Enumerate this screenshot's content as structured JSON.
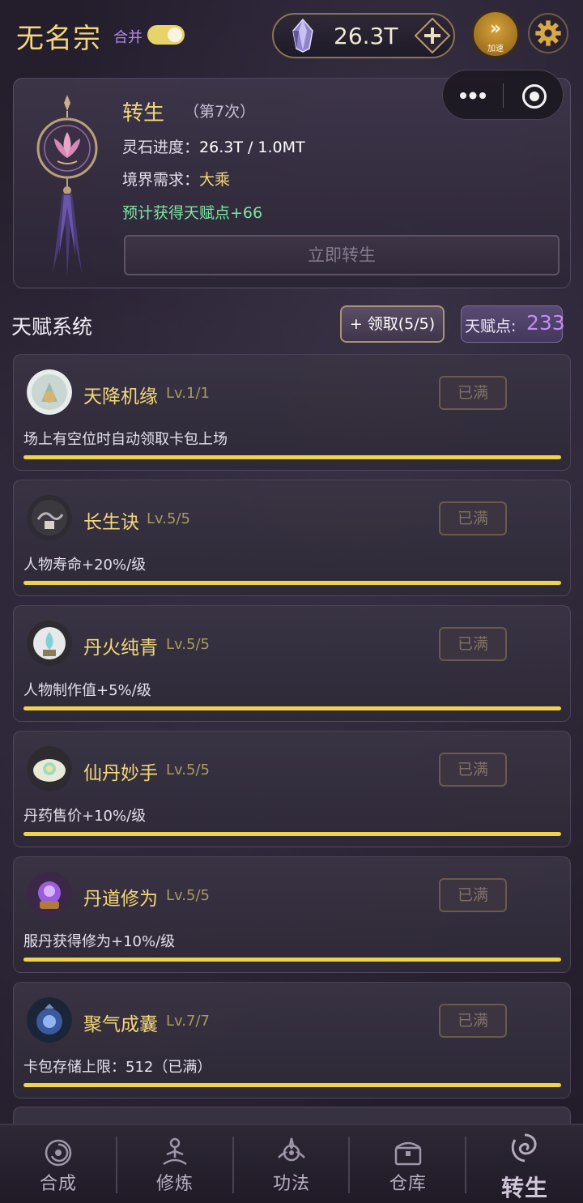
{
  "header": {
    "title": "无名宗",
    "merge_label": "合并",
    "merge_on": true,
    "currency_amount": "26.3T",
    "speed_label": "加速"
  },
  "rebirth": {
    "title": "转生",
    "count": "（第7次）",
    "progress_label": "灵石进度：",
    "progress_value": "26.3T / 1.0MT",
    "realm_label": "境界需求：",
    "realm_value": "大乘",
    "reward_text": "预计获得天赋点+66",
    "button_label": "立即转生"
  },
  "talents": {
    "section_title": "天赋系统",
    "claim_button": "+ 领取(5/5)",
    "points_label": "天赋点:",
    "points_value": "233",
    "items": [
      {
        "name": "天降机缘",
        "level": "Lv.1/1",
        "button": "已满",
        "desc": "场上有空位时自动领取卡包上场",
        "progress": 1.0,
        "icon": "blessing-orb-icon"
      },
      {
        "name": "长生诀",
        "level": "Lv.5/5",
        "button": "已满",
        "desc": "人物寿命+20%/级",
        "progress": 1.0,
        "icon": "longevity-scroll-icon"
      },
      {
        "name": "丹火纯青",
        "level": "Lv.5/5",
        "button": "已满",
        "desc": "人物制作值+5%/级",
        "progress": 1.0,
        "icon": "alchemy-fire-icon"
      },
      {
        "name": "仙丹妙手",
        "level": "Lv.5/5",
        "button": "已满",
        "desc": "丹药售价+10%/级",
        "progress": 1.0,
        "icon": "elixir-hands-icon"
      },
      {
        "name": "丹道修为",
        "level": "Lv.5/5",
        "button": "已满",
        "desc": "服丹获得修为+10%/级",
        "progress": 1.0,
        "icon": "purple-cauldron-icon"
      },
      {
        "name": "聚气成囊",
        "level": "Lv.7/7",
        "button": "已满",
        "desc": "卡包存储上限：512（已满）",
        "progress": 1.0,
        "icon": "qi-pouch-icon"
      }
    ]
  },
  "nav": {
    "items": [
      {
        "label": "合成",
        "icon": "swirl-icon"
      },
      {
        "label": "修炼",
        "icon": "meditation-icon"
      },
      {
        "label": "功法",
        "icon": "emblem-icon"
      },
      {
        "label": "仓库",
        "icon": "chest-icon"
      },
      {
        "label": "转生",
        "icon": "vortex-icon",
        "active": true
      }
    ]
  },
  "colors": {
    "gold": "#f3d77a",
    "purple_accent": "#c58bf6",
    "green_text": "#7fe6a6",
    "progress_fill": "#f0d34a"
  }
}
